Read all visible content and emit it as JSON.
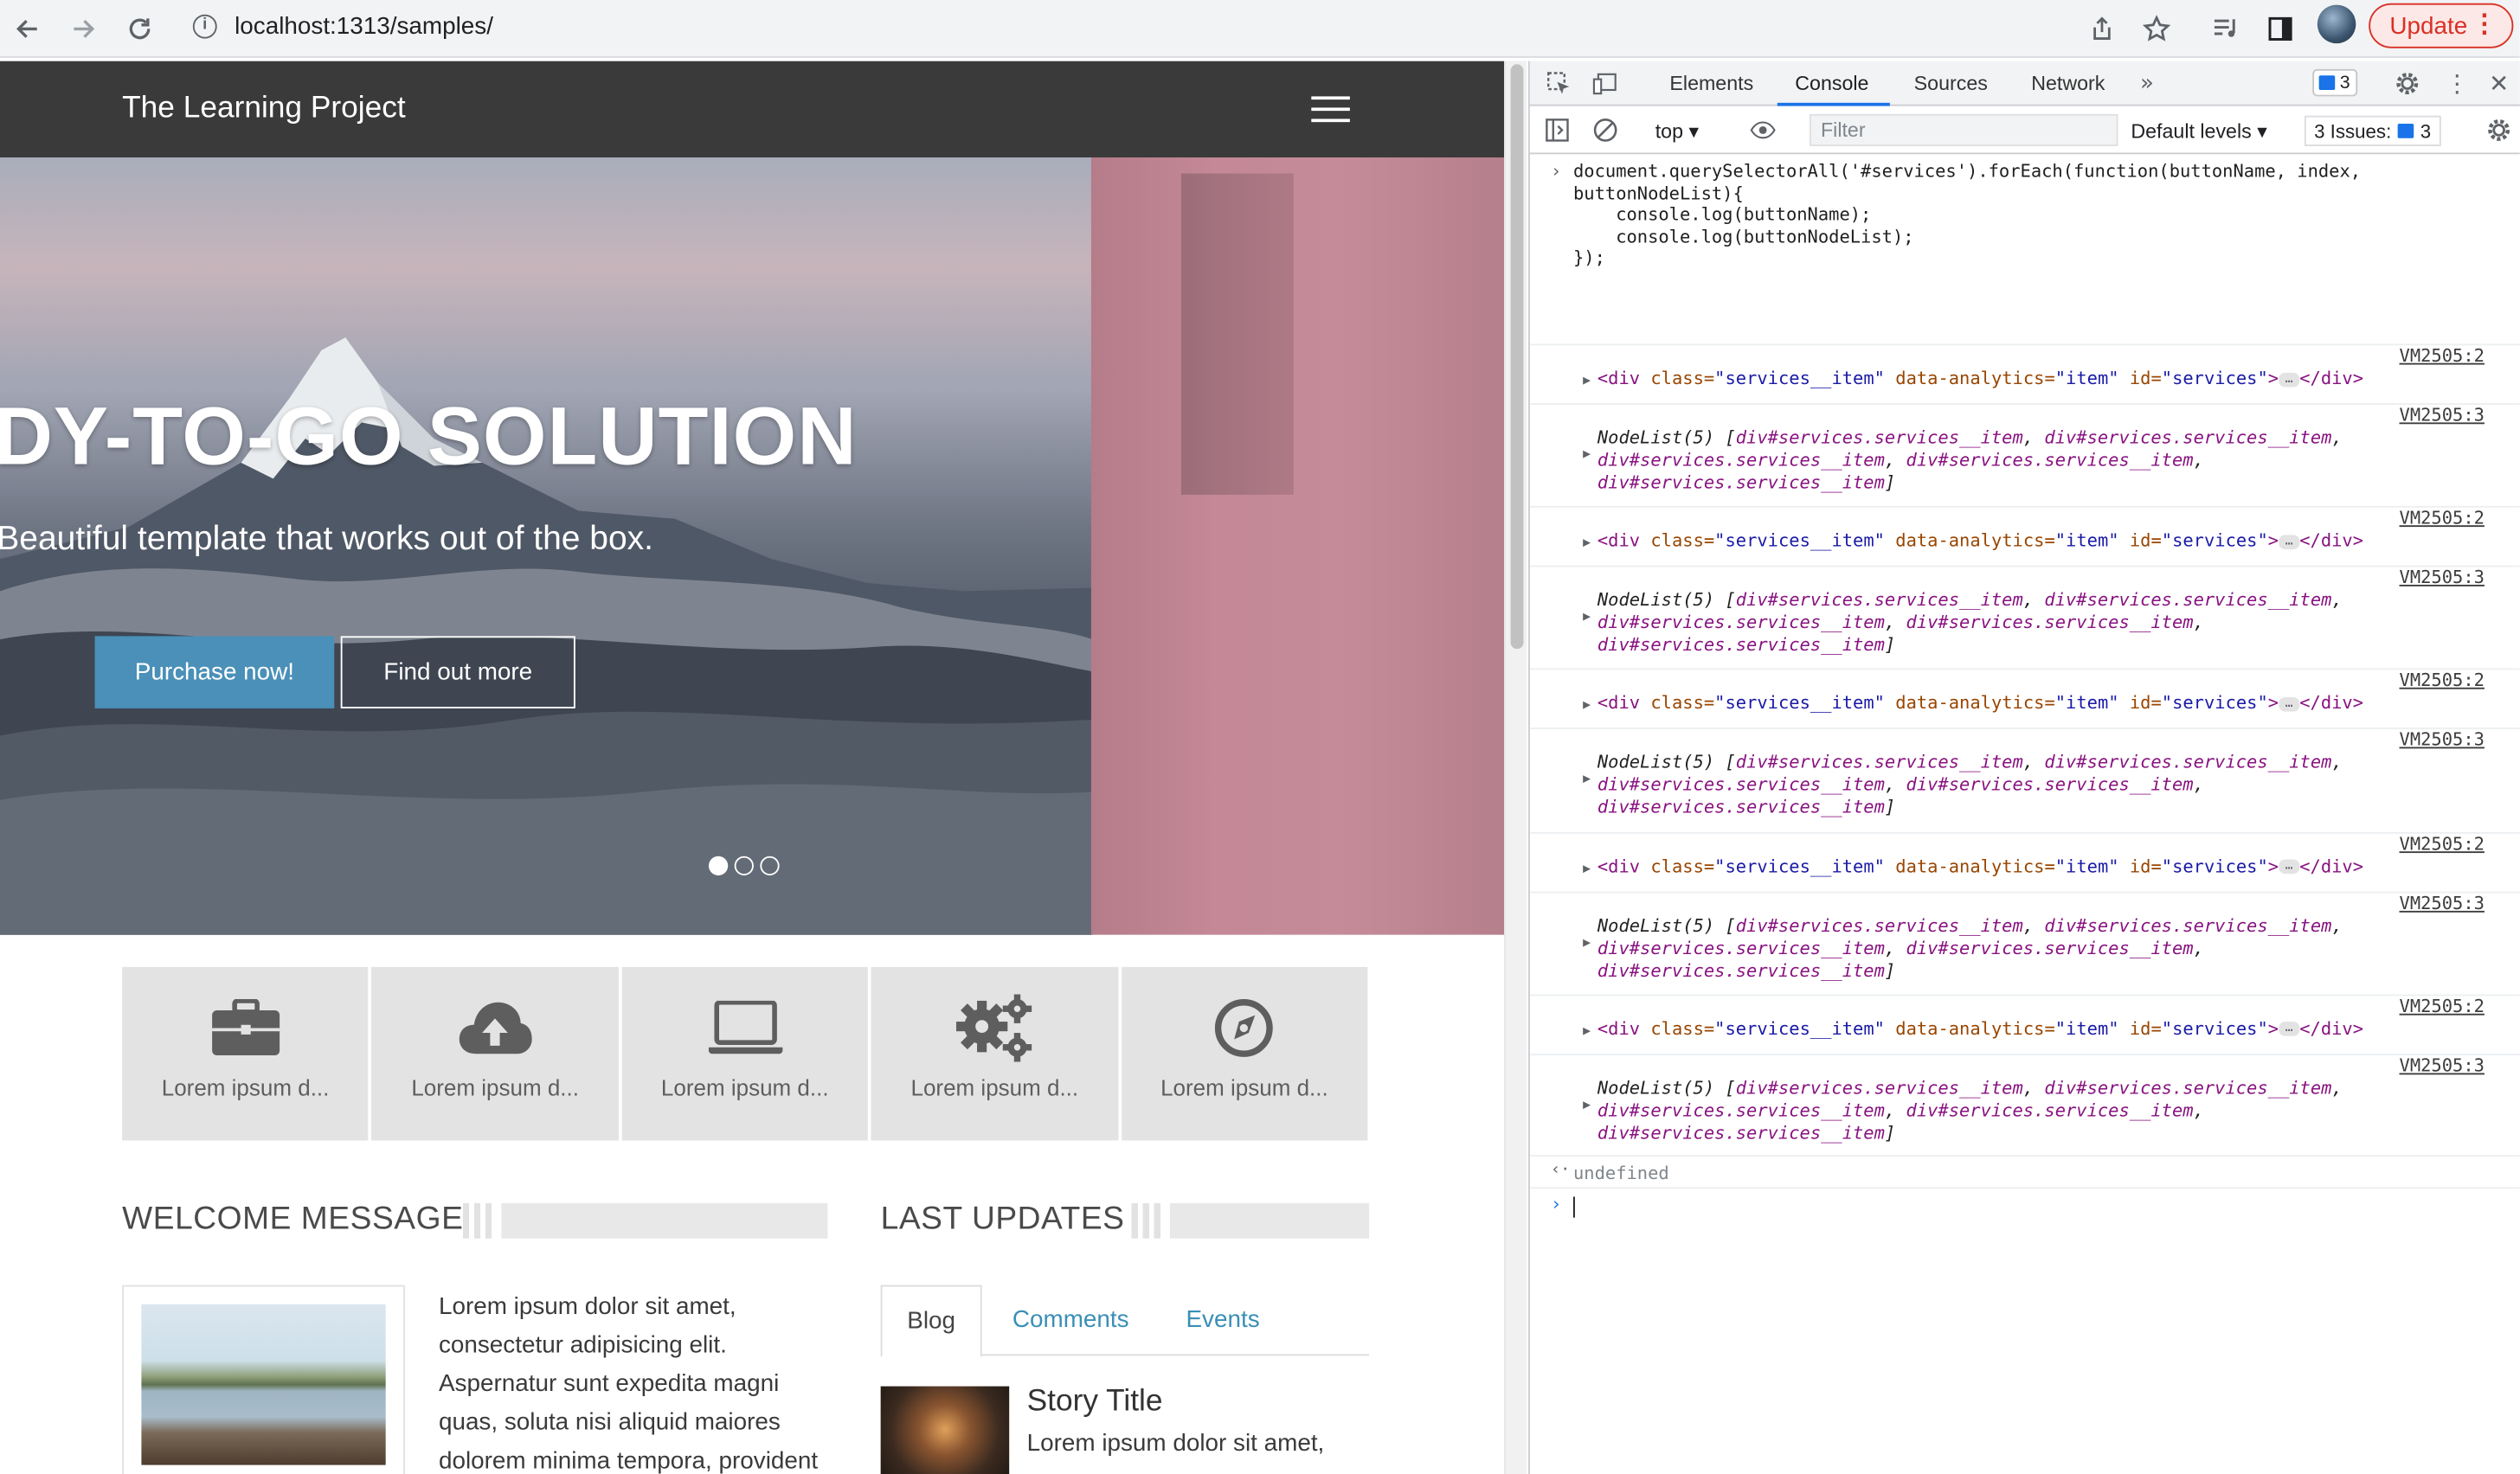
{
  "browser": {
    "url": "localhost:1313/samples/",
    "update_label": "Update"
  },
  "site": {
    "brand": "The Learning Project",
    "hero": {
      "title": "DY-TO-GO SOLUTION",
      "subtitle": "Beautiful template that works out of the box.",
      "primary_button": "Purchase now!",
      "secondary_button": "Find out more",
      "slides": 3,
      "active_slide": 1
    },
    "services": [
      {
        "icon": "briefcase-icon",
        "label": "Lorem ipsum d..."
      },
      {
        "icon": "cloud-upload-icon",
        "label": "Lorem ipsum d..."
      },
      {
        "icon": "laptop-icon",
        "label": "Lorem ipsum d..."
      },
      {
        "icon": "gears-icon",
        "label": "Lorem ipsum d..."
      },
      {
        "icon": "compass-icon",
        "label": "Lorem ipsum d..."
      }
    ],
    "welcome": {
      "title": "WELCOME MESSAGE",
      "text": "Lorem ipsum dolor sit amet, consectetur adipisicing elit. Aspernatur sunt expedita magni quas, soluta nisi aliquid maiores dolorem minima tempora, provident"
    },
    "updates": {
      "title": "LAST UPDATES",
      "tabs": [
        "Blog",
        "Comments",
        "Events"
      ],
      "active_tab": "Blog",
      "story_title": "Story Title",
      "story_text": "Lorem ipsum dolor sit amet,"
    }
  },
  "devtools": {
    "tabs": [
      "Elements",
      "Console",
      "Sources",
      "Network"
    ],
    "active_tab": "Console",
    "messages_count": "3",
    "context": "top",
    "filter_placeholder": "Filter",
    "levels": "Default levels",
    "issues_label": "3 Issues:",
    "issues_count": "3",
    "input_code": [
      "document.querySelectorAll('#services').forEach(function(buttonName, index,",
      "buttonNodeList){",
      "    console.log(buttonName);",
      "    console.log(buttonNodeList);",
      "});"
    ],
    "log_src_element": "VM2505:2",
    "log_src_nodelist": "VM2505:3",
    "element_open": "<div",
    "element_attr_class": "class=",
    "element_val_class": "\"services__item\"",
    "element_attr_data": "data-analytics=",
    "element_val_data": "\"item\"",
    "element_attr_id": "id=",
    "element_val_id": "\"services\"",
    "element_close": "</div>",
    "nodelist_head": "NodeList(5) [",
    "nodelist_item": "div#services.services__item",
    "nodelist_sep": ", ",
    "nodelist_end": "]",
    "result": "undefined"
  }
}
